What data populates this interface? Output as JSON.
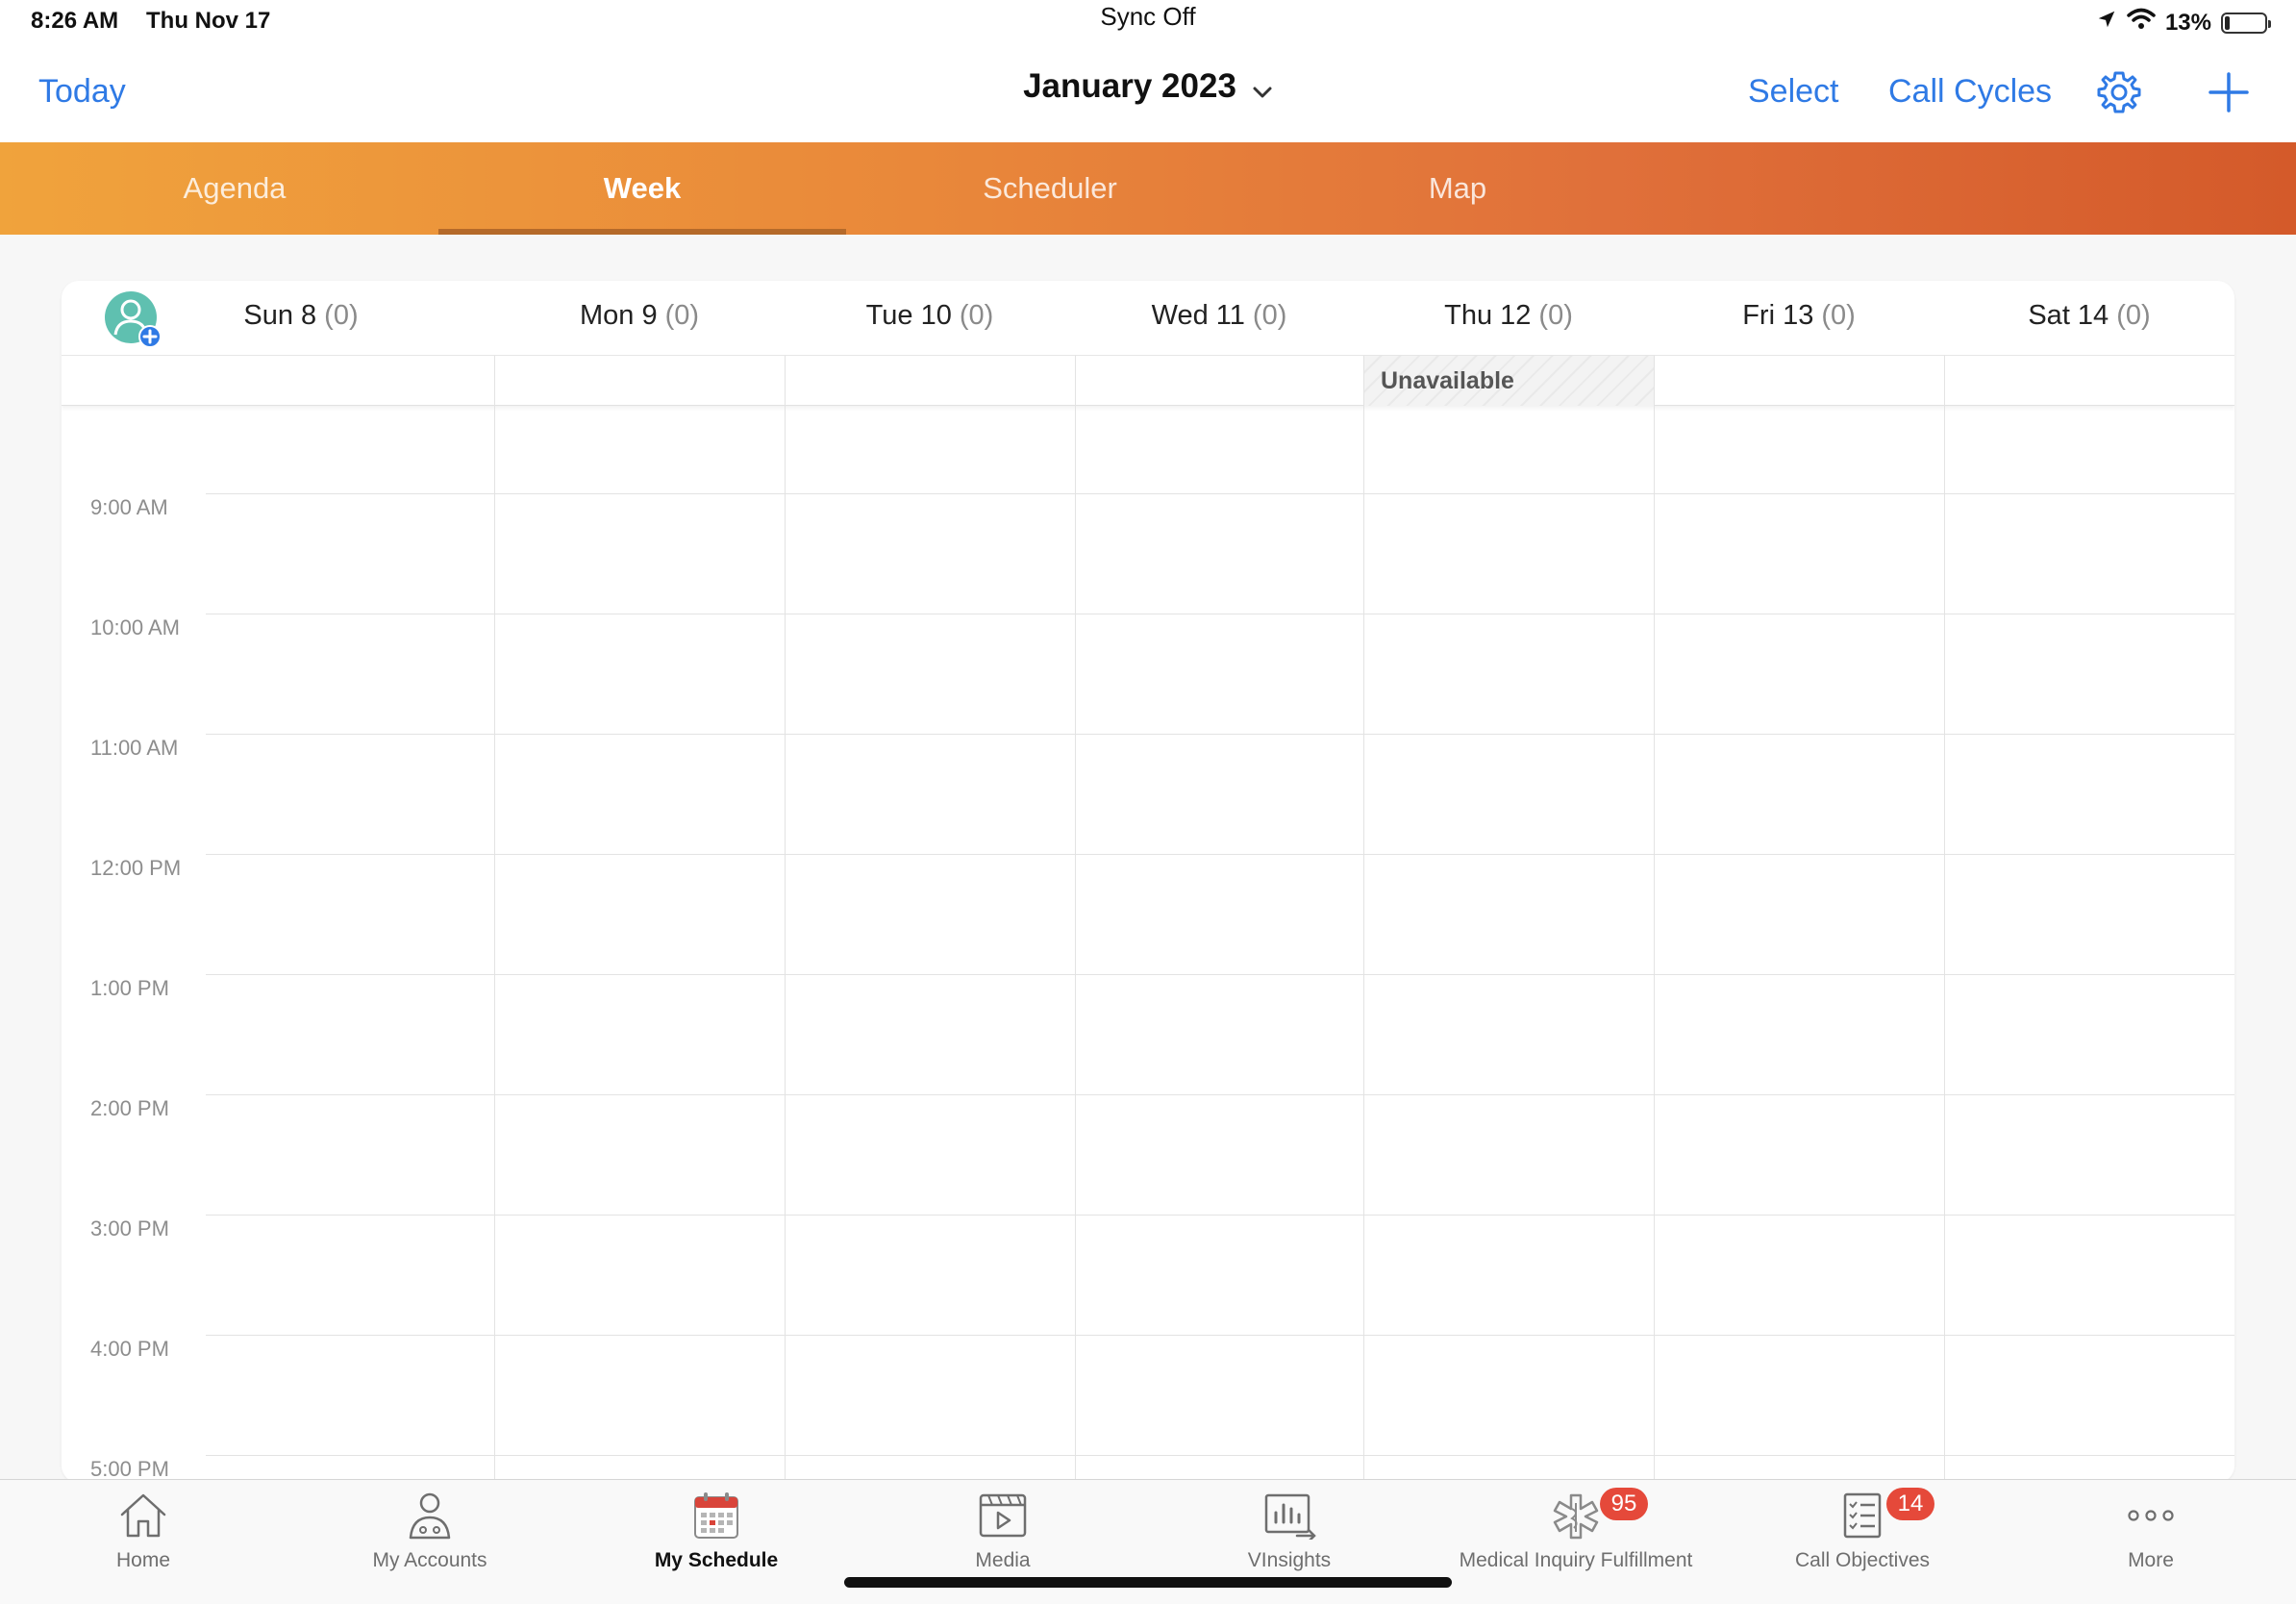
{
  "status_bar": {
    "time": "8:26 AM",
    "date": "Thu Nov 17",
    "sync": "Sync Off",
    "battery": "13%",
    "battery_level": 0.13
  },
  "nav": {
    "today": "Today",
    "title": "January 2023",
    "select": "Select",
    "call_cycles": "Call Cycles",
    "icons": [
      "gear-icon",
      "plus-icon",
      "chevron-down-icon"
    ]
  },
  "view_tabs": [
    {
      "label": "Agenda",
      "active": false
    },
    {
      "label": "Week",
      "active": true
    },
    {
      "label": "Scheduler",
      "active": false
    },
    {
      "label": "Map",
      "active": false
    }
  ],
  "calendar": {
    "days": [
      {
        "label": "Sun 8",
        "count": "(0)"
      },
      {
        "label": "Mon 9",
        "count": "(0)"
      },
      {
        "label": "Tue 10",
        "count": "(0)"
      },
      {
        "label": "Wed 11",
        "count": "(0)"
      },
      {
        "label": "Thu 12",
        "count": "(0)"
      },
      {
        "label": "Fri 13",
        "count": "(0)"
      },
      {
        "label": "Sat 14",
        "count": "(0)"
      }
    ],
    "unavailable": {
      "label": "Unavailable",
      "day": "Thu 12"
    },
    "time_slots": [
      "9:00 AM",
      "10:00 AM",
      "11:00 AM",
      "12:00 PM",
      "1:00 PM",
      "2:00 PM",
      "3:00 PM",
      "4:00 PM",
      "5:00 PM"
    ]
  },
  "bottom_tabs": [
    {
      "label": "Home",
      "icon": "home-icon",
      "active": false,
      "badge": ""
    },
    {
      "label": "My Accounts",
      "icon": "person-icon",
      "active": false,
      "badge": ""
    },
    {
      "label": "My Schedule",
      "icon": "calendar-icon",
      "active": true,
      "badge": ""
    },
    {
      "label": "Media",
      "icon": "media-icon",
      "active": false,
      "badge": ""
    },
    {
      "label": "VInsights",
      "icon": "insights-icon",
      "active": false,
      "badge": ""
    },
    {
      "label": "Medical Inquiry Fulfillment",
      "icon": "medical-icon",
      "active": false,
      "badge": "95"
    },
    {
      "label": "Call Objectives",
      "icon": "checklist-icon",
      "active": false,
      "badge": "14"
    },
    {
      "label": "More",
      "icon": "more-icon",
      "active": false,
      "badge": ""
    }
  ],
  "colors": {
    "accent_blue": "#2f7ae5",
    "tab_gradient_start": "#f0a33c",
    "tab_gradient_end": "#d45a2a",
    "badge_red": "#e5493a",
    "schedule_icon_red": "#d9443a"
  }
}
